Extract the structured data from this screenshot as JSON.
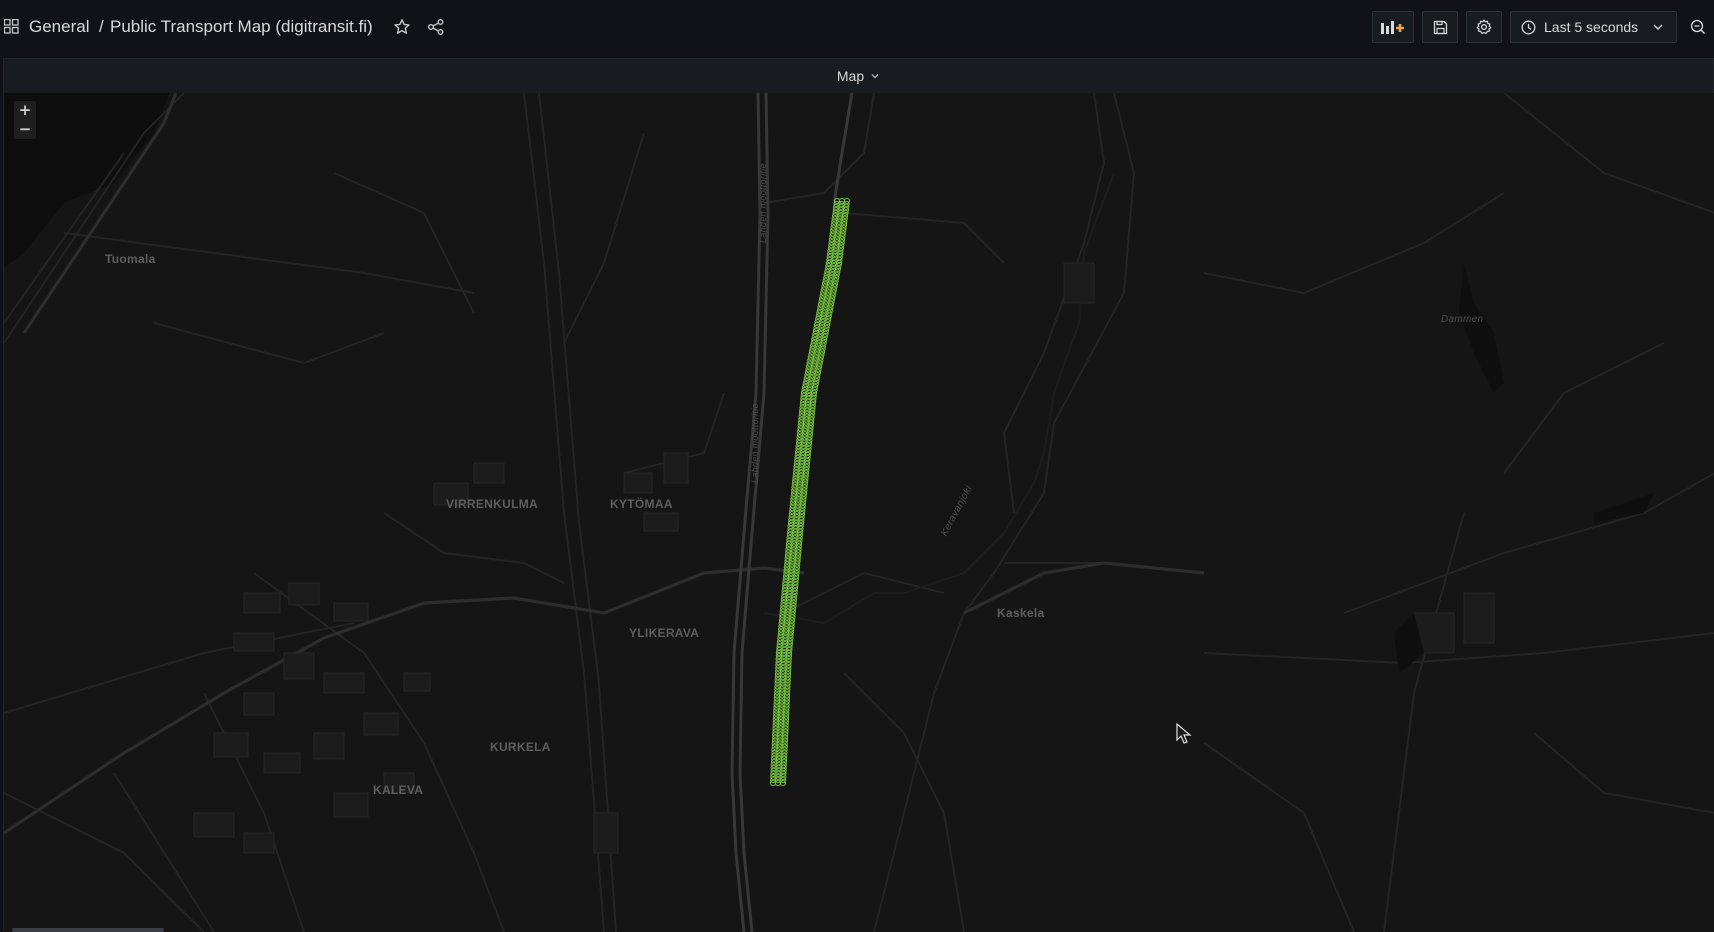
{
  "breadcrumb": {
    "folder": "General",
    "separator": "/",
    "title": "Public Transport Map (digitransit.fi)"
  },
  "toolbar": {
    "time_range": "Last 5 seconds"
  },
  "panel": {
    "title": "Map"
  },
  "map": {
    "zoom_in": "+",
    "zoom_out": "−",
    "places": [
      "Tuomala",
      "VIRRENKULMA",
      "KYTÖMAA",
      "YLIKERAVA",
      "Kaskela",
      "KURKELA",
      "KALEVA",
      "Dammen",
      "Keravanjoki",
      "Lahden moottoritie"
    ],
    "marker_color": "#73bf3c"
  },
  "colors": {
    "background": "#111217",
    "panel": "#181b1f",
    "map_bg": "#151515",
    "road": "#2a2a2a",
    "marker": "#73bf3c"
  }
}
